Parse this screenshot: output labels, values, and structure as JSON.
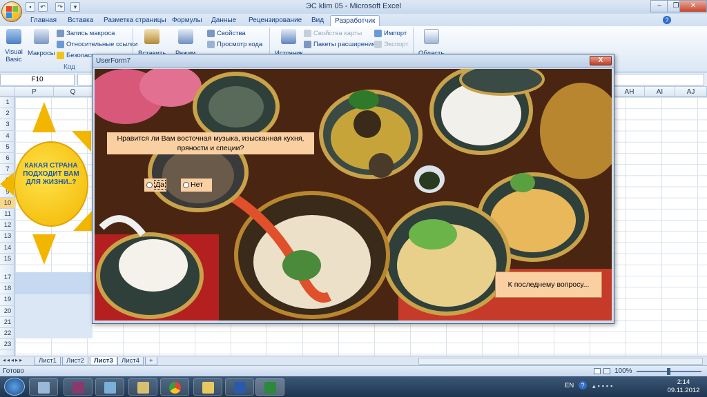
{
  "window": {
    "title": "ЭС klim 05  -  Microsoft Excel"
  },
  "quick_access": {
    "icons": [
      "save-icon",
      "undo-icon",
      "redo-icon",
      "customize-icon"
    ]
  },
  "ribbon_tabs": [
    "Главная",
    "Вставка",
    "Разметка страницы",
    "Формулы",
    "Данные",
    "Рецензирование",
    "Вид",
    "Разработчик"
  ],
  "active_tab": "Разработчик",
  "ribbon": {
    "code_group": {
      "visual_basic": "Visual Basic",
      "macros": "Макросы",
      "record_macro": "Запись макроса",
      "relative_refs": "Относительные ссылки",
      "security": "Безопасн",
      "group_label": "Код"
    },
    "controls_group": {
      "insert": "Вставить",
      "design_mode": "Режим",
      "properties": "Свойства",
      "view_code": "Просмотр кода"
    },
    "xml_group": {
      "source": "Источник",
      "map_properties": "Свойства карты",
      "expansion_packs": "Пакеты расширения",
      "import": "Импорт",
      "export": "Экспорт"
    },
    "modify_group": {
      "area": "Область"
    }
  },
  "formula_bar": {
    "name_box": "F10"
  },
  "columns_left": [
    "P",
    "Q"
  ],
  "columns_right": [
    "AH",
    "AI",
    "AJ"
  ],
  "rows": [
    "1",
    "2",
    "3",
    "4",
    "5",
    "6",
    "7",
    "8",
    "9",
    "10",
    "11",
    "12",
    "13",
    "14",
    "15",
    "16",
    "17",
    "18",
    "19",
    "20",
    "21",
    "22",
    "23"
  ],
  "sun_text": "КАКАЯ СТРАНА ПОДХОДИТ ВАМ ДЛЯ ЖИЗНИ..?",
  "sheet_tabs": [
    "Лист1",
    "Лист2",
    "Лист3",
    "Лист4"
  ],
  "active_sheet": "Лист3",
  "status": {
    "ready": "Готово",
    "zoom": "100%"
  },
  "userform": {
    "title": "UserForm7",
    "close": "X",
    "question": "Нравится ли Вам восточная музыка, изысканная кухня, пряности и специи?",
    "option_yes": "Да",
    "option_no": "Нет",
    "next_button": "К последнему вопросу..."
  },
  "taskbar": {
    "lang": "EN",
    "time": "2:14",
    "date": "09.11.2012"
  },
  "colors": {
    "accent": "#fad0a3",
    "sun": "#f2b600",
    "ribbon": "#dbe7f5"
  }
}
